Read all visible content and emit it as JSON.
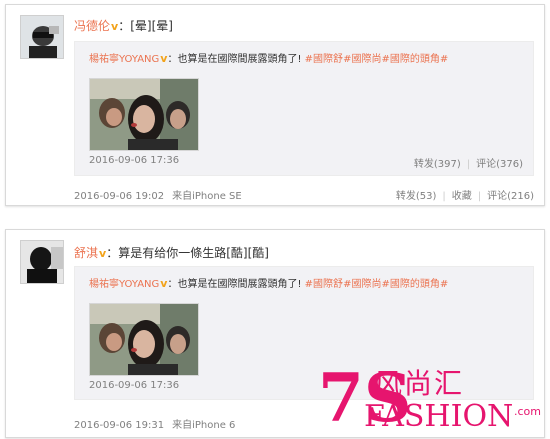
{
  "posts": [
    {
      "user": "冯德伦",
      "verified_badge": "v",
      "content": "[晕][晕]",
      "repost": {
        "user": "楊祐寧YOYANG",
        "verified_badge": "v",
        "text": "也算是在國際間展露頭角了!",
        "hashtags": [
          "#國際舒",
          "#國際尚",
          "#國際的頭角#"
        ],
        "time": "2016-09-06 17:36",
        "reposts": "转发(397)",
        "comments": "评论(376)"
      },
      "time": "2016-09-06 19:02",
      "source": "来自iPhone SE",
      "actions": {
        "repost": "转发(53)",
        "favorite": "收藏",
        "comment": "评论(216)"
      }
    },
    {
      "user": "舒淇",
      "verified_badge": "v",
      "content": "算是有给你一條生路[酷][酷]",
      "repost": {
        "user": "楊祐寧YOYANG",
        "verified_badge": "v",
        "text": "也算是在國際間展露頭角了!",
        "hashtags": [
          "#國際舒",
          "#國際尚",
          "#國際的頭角#"
        ],
        "time": "2016-09-06 17:36"
      },
      "time": "2016-09-06 19:31",
      "source": "来自iPhone 6"
    }
  ],
  "watermark": {
    "number": "7S",
    "chinese": "风尚汇",
    "english": "FASHION",
    "suffix": ".com"
  },
  "colors": {
    "username": "#eb7350",
    "meta": "#808080",
    "repost_bg": "#f2f2f5",
    "watermark": "#e6156e"
  }
}
